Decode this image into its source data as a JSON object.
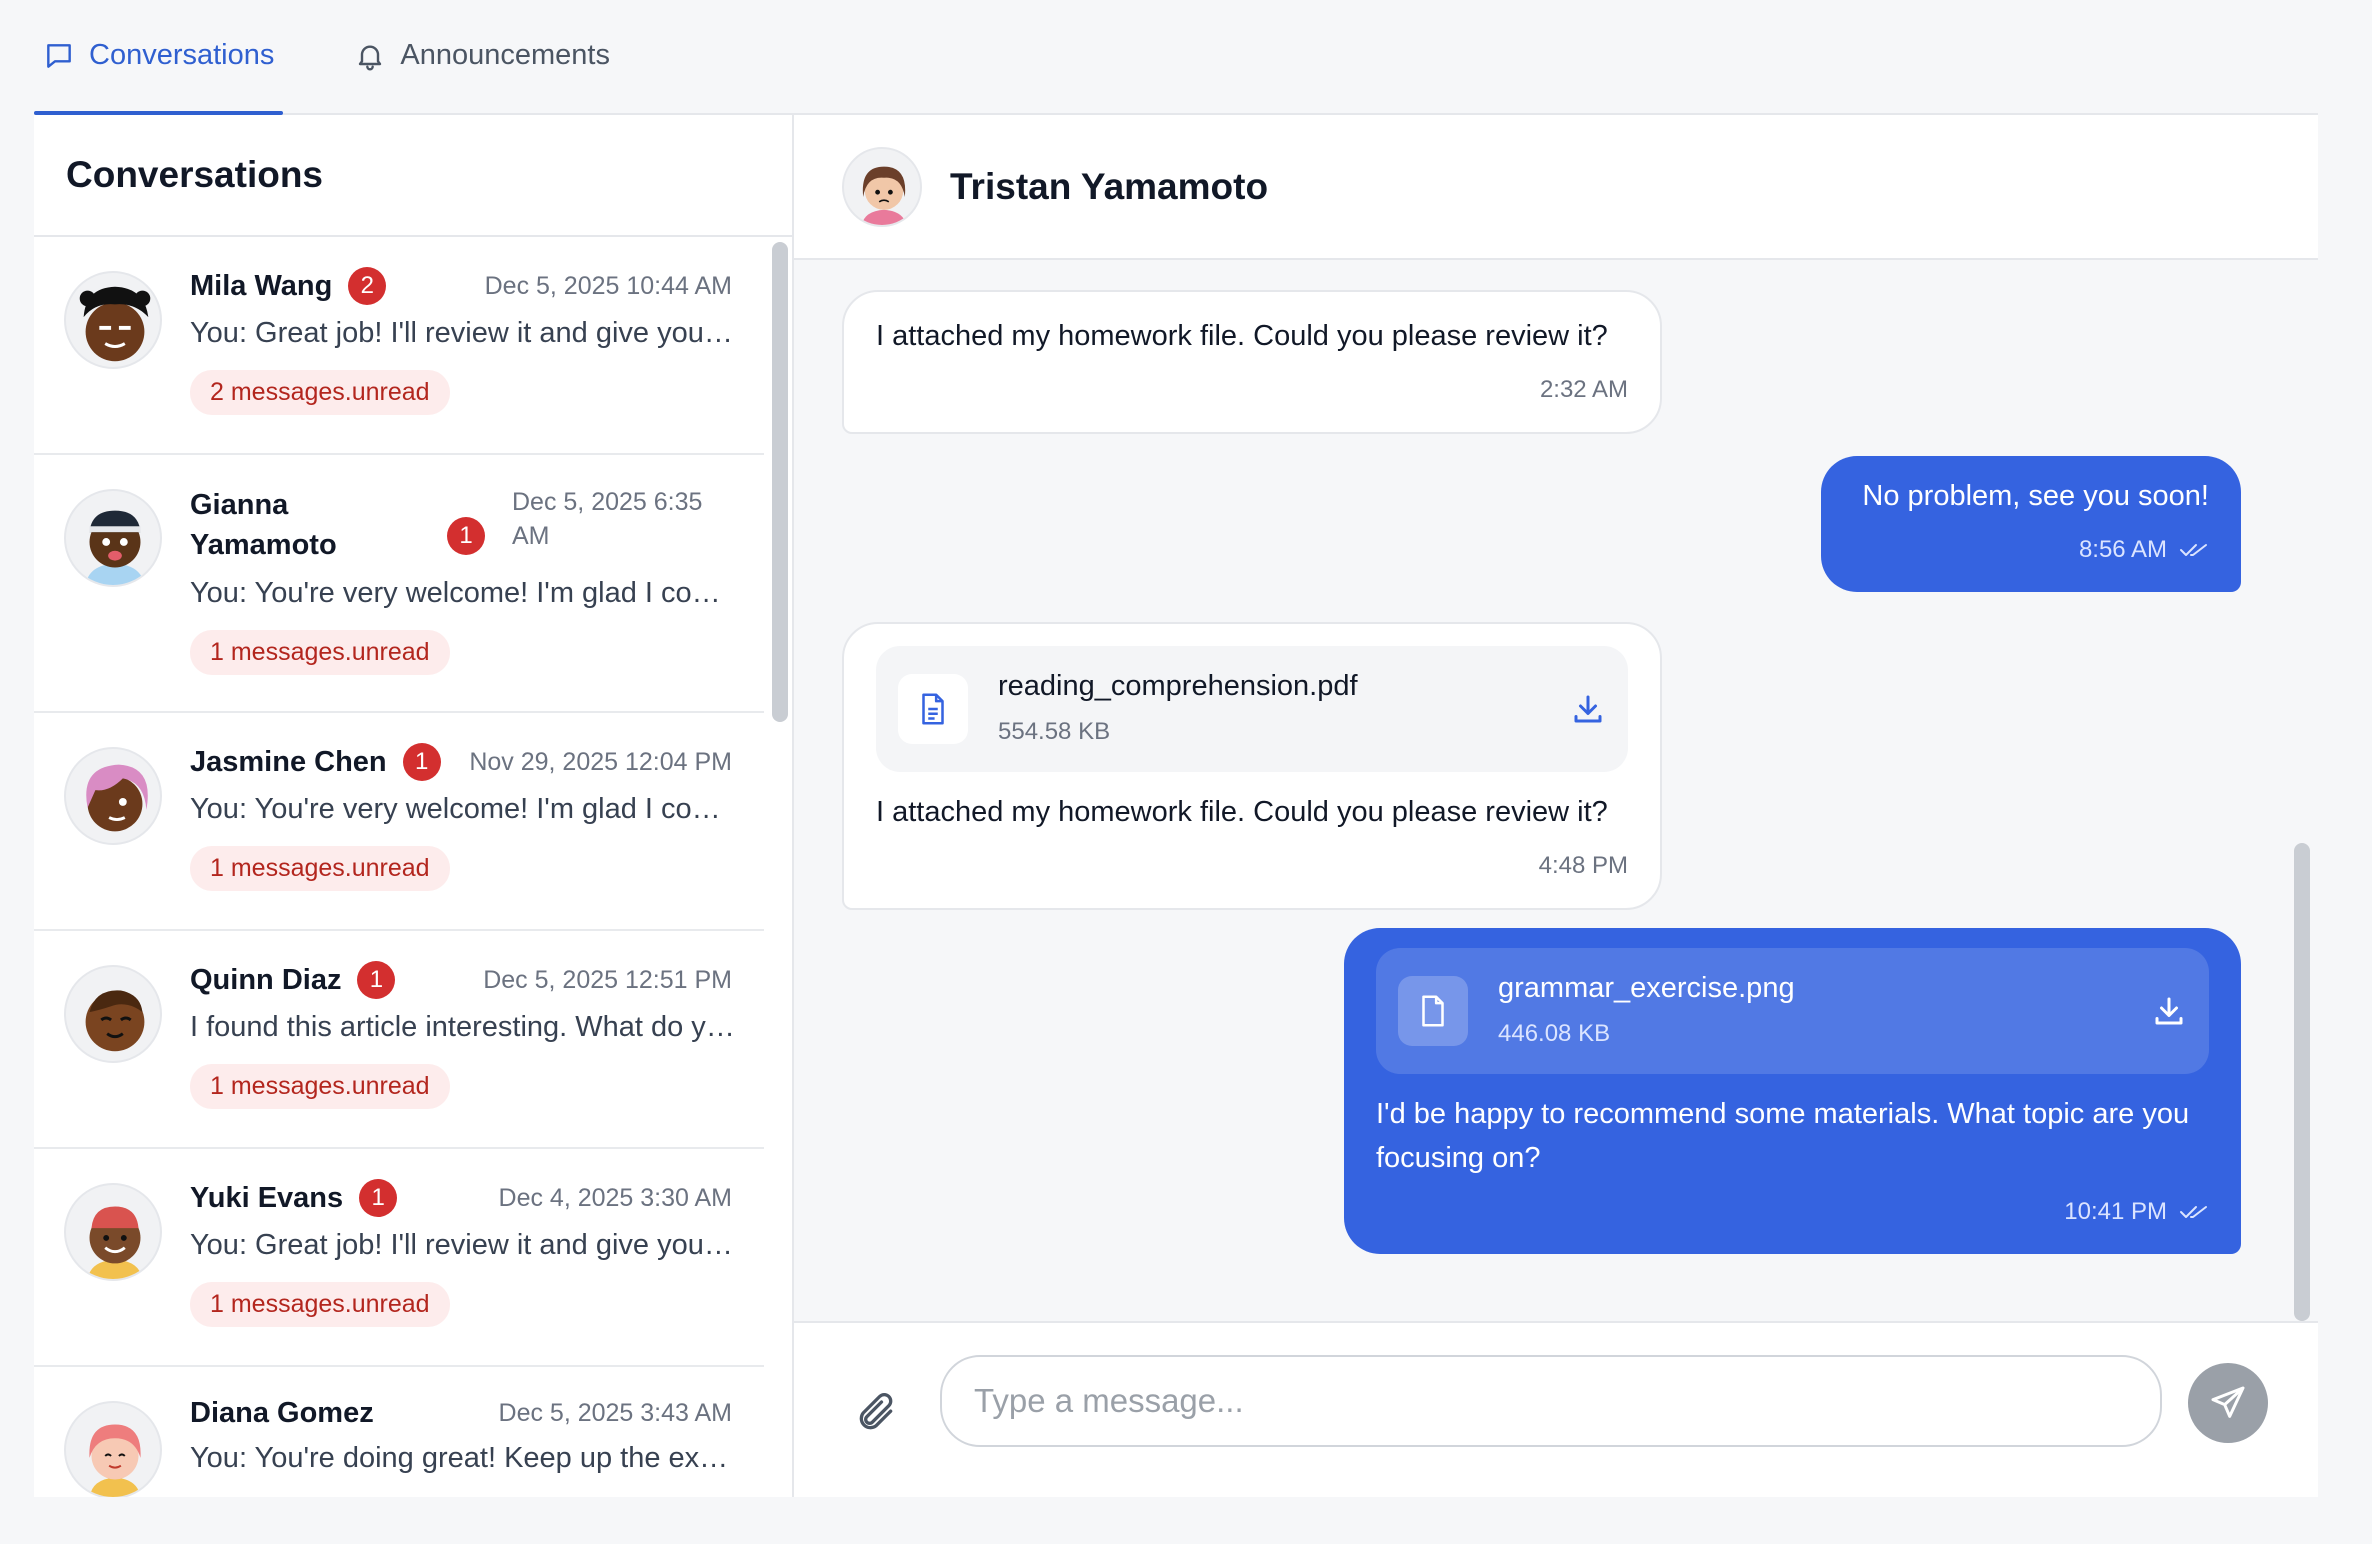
{
  "tabs": [
    {
      "label": "Conversations",
      "icon": "chat-icon",
      "active": true
    },
    {
      "label": "Announcements",
      "icon": "bell-icon",
      "active": false
    }
  ],
  "sidebar": {
    "title": "Conversations",
    "conversations": [
      {
        "name": "Mila Wang",
        "unread_count": "2",
        "time": "Dec 5, 2025 10:44 AM",
        "preview": "You: Great job! I'll review it and give you feedback soon.",
        "unread_label": "2 messages.unread"
      },
      {
        "name": "Gianna Yamamoto",
        "unread_count": "1",
        "time": "Dec 5, 2025 6:35 AM",
        "preview": "You: You're very welcome! I'm glad I could help.",
        "unread_label": "1 messages.unread"
      },
      {
        "name": "Jasmine Chen",
        "unread_count": "1",
        "time": "Nov 29, 2025 12:04 PM",
        "preview": "You: You're very welcome! I'm glad I could help.",
        "unread_label": "1 messages.unread"
      },
      {
        "name": "Quinn Diaz",
        "unread_count": "1",
        "time": "Dec 5, 2025 12:51 PM",
        "preview": "I found this article interesting. What do you think?",
        "unread_label": "1 messages.unread"
      },
      {
        "name": "Yuki Evans",
        "unread_count": "1",
        "time": "Dec 4, 2025 3:30 AM",
        "preview": "You: Great job! I'll review it and give you feedback soon.",
        "unread_label": "1 messages.unread"
      },
      {
        "name": "Diana Gomez",
        "time": "Dec 5, 2025 3:43 AM",
        "preview": "You: You're doing great! Keep up the excellent work."
      }
    ]
  },
  "chat": {
    "contact_name": "Tristan Yamamoto",
    "messages": [
      {
        "direction": "in",
        "text": "I attached my homework file. Could you please review it?",
        "time": "2:32 AM"
      },
      {
        "direction": "out",
        "text": "No problem, see you soon!",
        "time": "8:56 AM"
      },
      {
        "direction": "in",
        "file_name": "reading_comprehension.pdf",
        "file_size": "554.58 KB",
        "text": "I attached my homework file. Could you please review it?",
        "time": "4:48 PM"
      },
      {
        "direction": "out",
        "file_name": "grammar_exercise.png",
        "file_size": "446.08 KB",
        "text": "I'd be happy to recommend some materials. What topic are you focusing on?",
        "time": "10:41 PM"
      }
    ]
  },
  "composer": {
    "placeholder": "Type a message..."
  },
  "colors": {
    "accent": "#3563e0",
    "tab_active": "#2f5fd0",
    "badge": "#d32f2f",
    "unread_pill_bg": "#fdecec",
    "unread_pill_text": "#b3261e"
  }
}
